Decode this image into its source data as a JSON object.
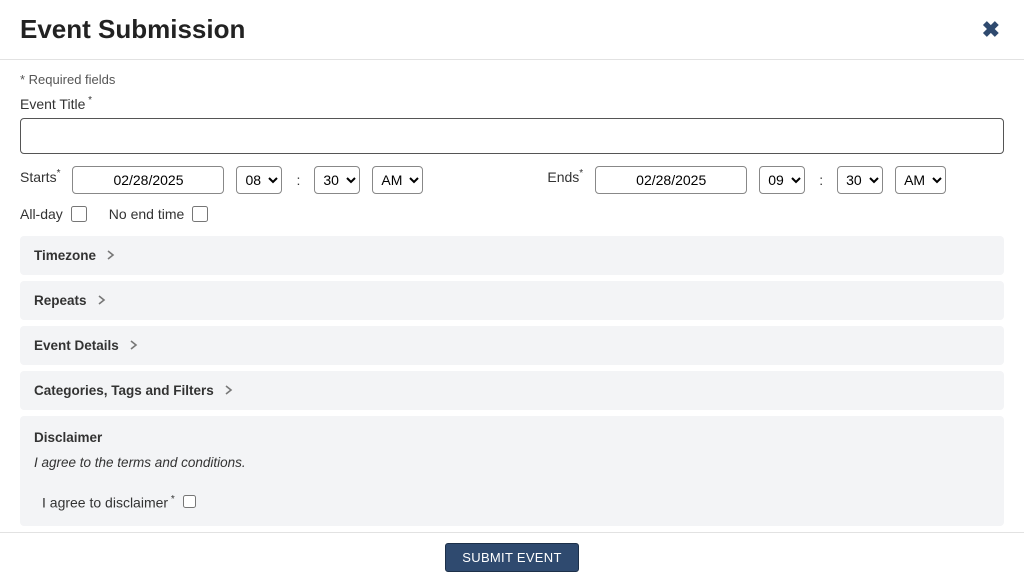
{
  "header": {
    "title": "Event Submission"
  },
  "required_note": "* Required fields",
  "event_title_label": "Event Title",
  "event_title_value": "",
  "starts": {
    "label": "Starts",
    "date": "02/28/2025",
    "hour": "08",
    "minute": "30",
    "period": "AM"
  },
  "ends": {
    "label": "Ends",
    "date": "02/28/2025",
    "hour": "09",
    "minute": "30",
    "period": "AM"
  },
  "allday_label": "All-day",
  "noend_label": "No end time",
  "accordion": {
    "timezone": "Timezone",
    "repeats": "Repeats",
    "event_details": "Event Details",
    "categories": "Categories, Tags and Filters"
  },
  "disclaimer": {
    "title": "Disclaimer",
    "text": "I agree to the terms and conditions.",
    "agree_label": "I agree to disclaimer"
  },
  "submit_label": "SUBMIT EVENT"
}
